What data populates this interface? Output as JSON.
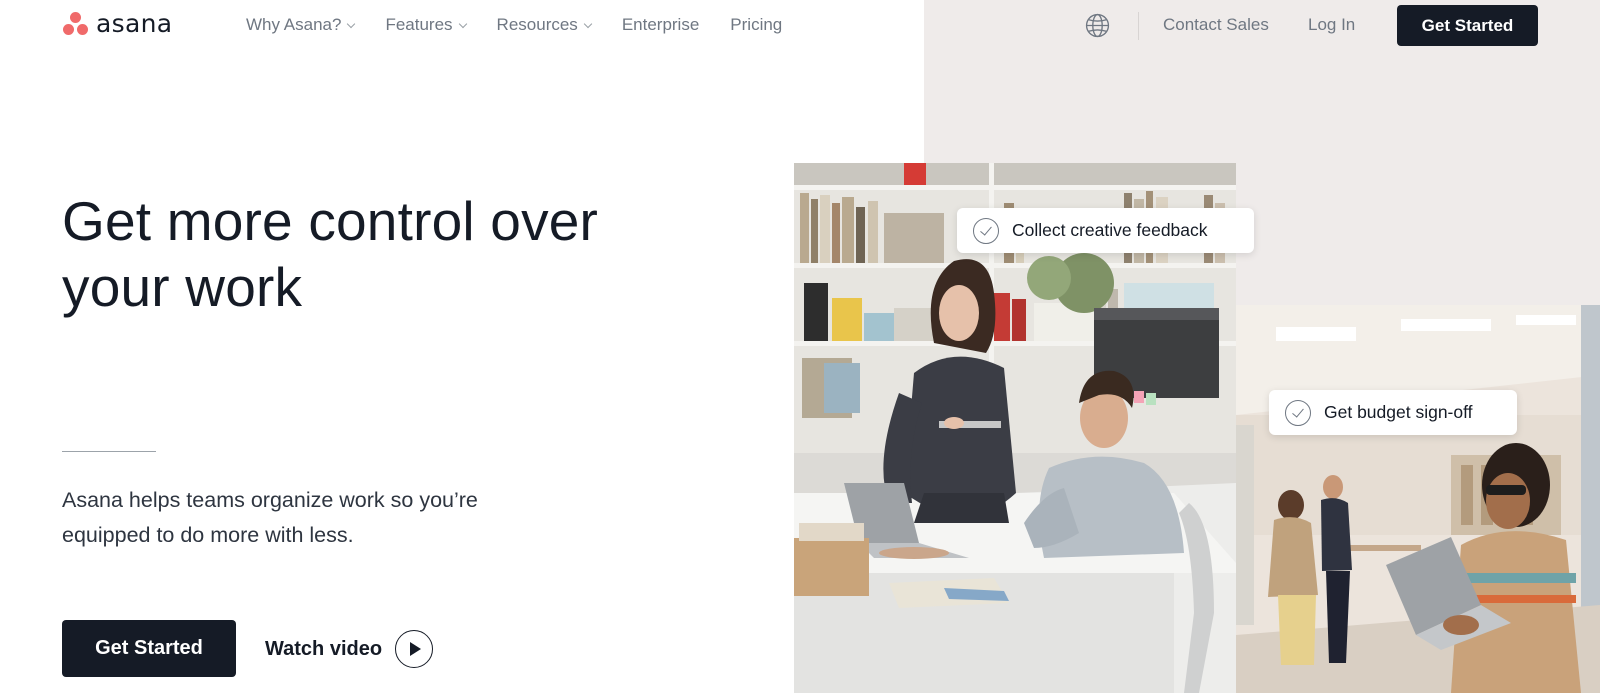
{
  "brand": {
    "name": "asana",
    "accent": "#f06a6a",
    "dark": "#151b26"
  },
  "nav": {
    "links": [
      {
        "label": "Why Asana?",
        "dropdown": true
      },
      {
        "label": "Features",
        "dropdown": true
      },
      {
        "label": "Resources",
        "dropdown": true
      },
      {
        "label": "Enterprise",
        "dropdown": false
      },
      {
        "label": "Pricing",
        "dropdown": false
      }
    ],
    "globe_icon": "globe-icon",
    "contact": "Contact Sales",
    "login": "Log In",
    "cta": "Get Started"
  },
  "hero": {
    "headline": "Get more control over your work",
    "subtext": "Asana helps teams organize work so you’re equipped to do more with less.",
    "cta": "Get Started",
    "watch": "Watch video"
  },
  "cards": [
    {
      "label": "Collect creative feedback"
    },
    {
      "label": "Get budget sign-off"
    }
  ]
}
